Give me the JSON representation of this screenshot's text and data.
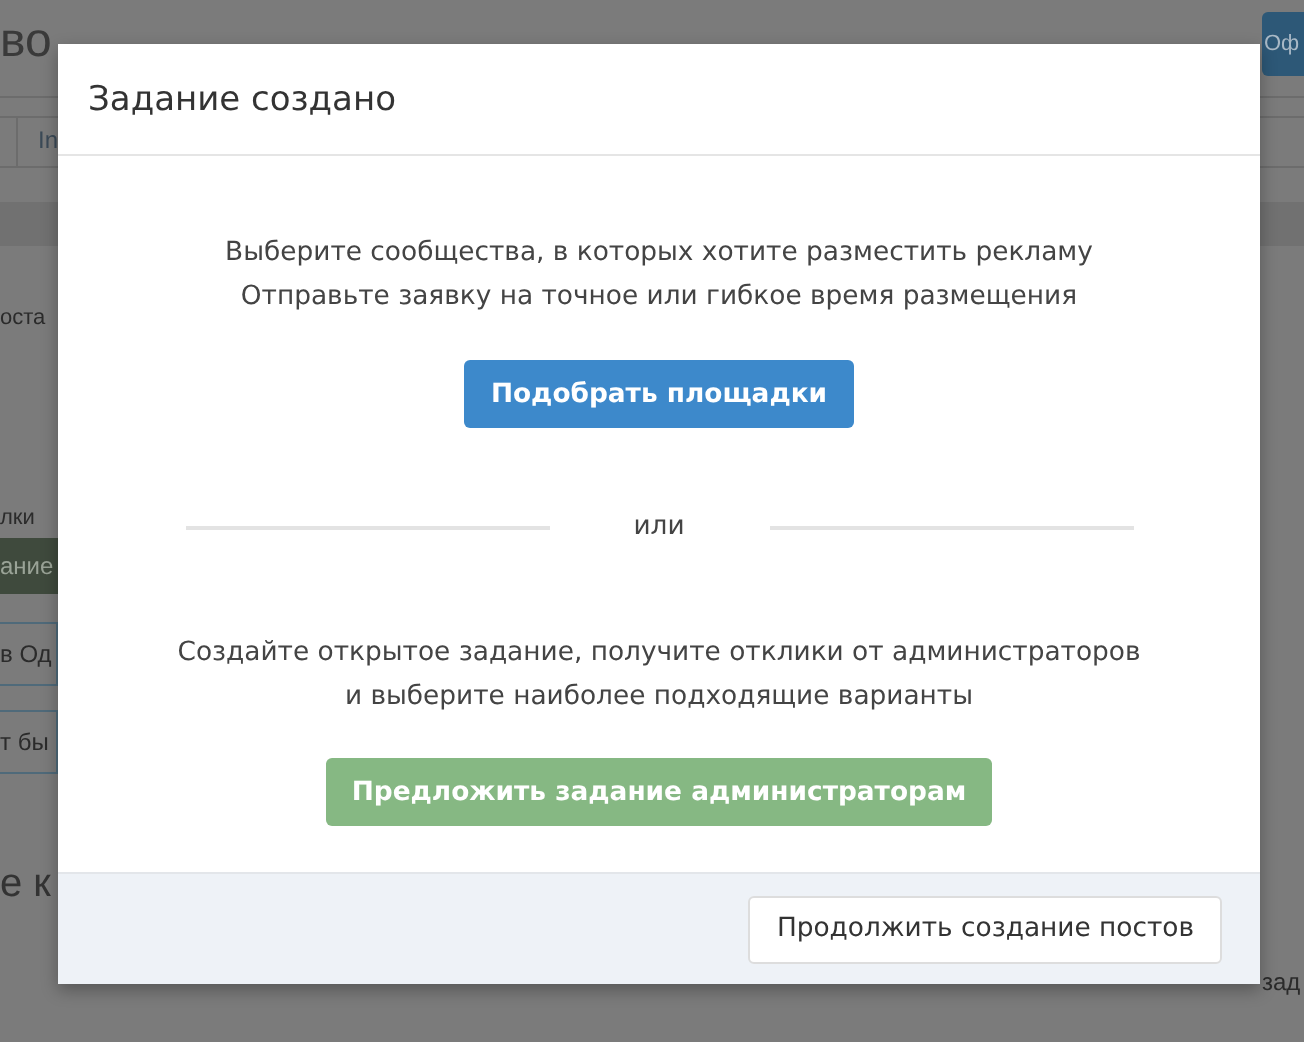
{
  "background_page": {
    "title": "во",
    "action_button": "Оф",
    "tab": "In",
    "fragments": [
      {
        "kind": "text",
        "text": "оста"
      },
      {
        "kind": "text",
        "text": "лки"
      },
      {
        "kind": "bar",
        "text": "ание"
      },
      {
        "kind": "boxed",
        "text": "в Од"
      },
      {
        "kind": "boxed",
        "text": "т бы"
      }
    ],
    "section_title": "е к",
    "table_text": "зад"
  },
  "modal": {
    "title": "Задание создано",
    "option_1": {
      "lines": [
        "Выберите сообщества, в которых хотите разместить рекламу",
        "Отправьте заявку на точное или гибкое время размещения"
      ],
      "button": "Подобрать площадки"
    },
    "separator": "или",
    "option_2": {
      "lines": [
        "Создайте открытое задание, получите отклики от администраторов",
        "и выберите наиболее подходящие варианты"
      ],
      "button": "Предложить задание администраторам"
    },
    "footer_button": "Продолжить создание постов"
  }
}
